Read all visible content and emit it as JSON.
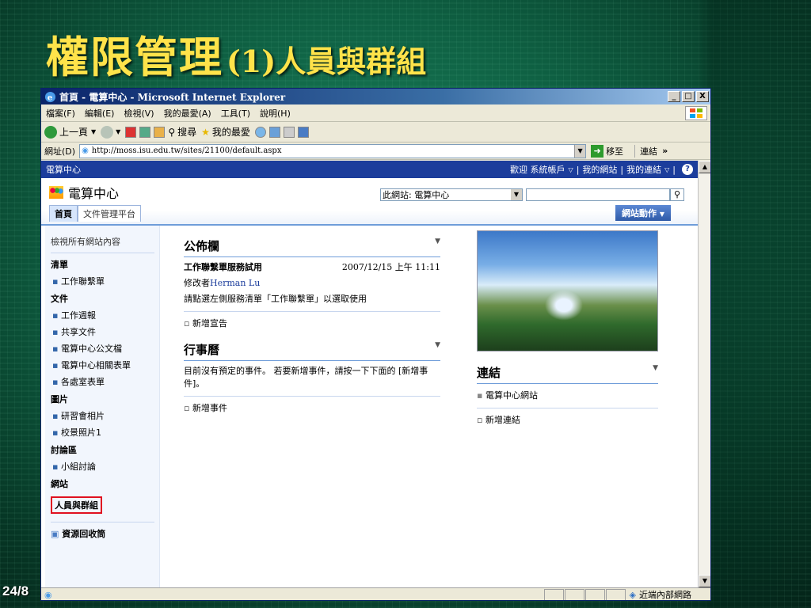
{
  "slide": {
    "title_main": "權限管理",
    "title_sub": "(1)人員與群組",
    "page_number": "24/8"
  },
  "window": {
    "title": "首頁 - 電算中心 - Microsoft Internet Explorer",
    "controls": [
      "_",
      "□",
      "X"
    ]
  },
  "menu": [
    "檔案(F)",
    "編輯(E)",
    "檢視(V)",
    "我的最愛(A)",
    "工具(T)",
    "說明(H)"
  ],
  "toolbar": {
    "back": "上一頁",
    "search": "搜尋",
    "favorites": "我的最愛"
  },
  "address": {
    "label": "網址(D)",
    "url": "http://moss.isu.edu.tw/sites/21100/default.aspx",
    "go": "移至",
    "links": "連結"
  },
  "topnav": {
    "site": "電算中心",
    "welcome": "歡迎 系統帳戶",
    "my_site": "我的網站",
    "my_links": "我的連結"
  },
  "header": {
    "site_name": "電算中心",
    "scope": "此網站: 電算中心",
    "tabs": [
      "首頁",
      "文件管理平台"
    ],
    "site_actions": "網站動作"
  },
  "leftnav": {
    "view_all": "檢視所有網站內容",
    "sections": [
      {
        "title": "清單",
        "items": [
          "工作聯繫單"
        ]
      },
      {
        "title": "文件",
        "items": [
          "工作週報",
          "共享文件",
          "電算中心公文檔",
          "電算中心相關表單",
          "各處室表單"
        ]
      },
      {
        "title": "圖片",
        "items": [
          "研習會相片",
          "校景照片1"
        ]
      },
      {
        "title": "討論區",
        "items": [
          "小組討論"
        ]
      }
    ],
    "site_section": "網站",
    "people_groups": "人員與群組",
    "recycle_bin": "資源回收筒"
  },
  "announcements": {
    "title": "公佈欄",
    "item_title": "工作聯繫單服務試用",
    "item_date": "2007/12/15 上午 11:11",
    "modified_prefix": "修改者",
    "modified_by": "Herman Lu",
    "body": "請點選左側服務清單「工作聯繫單」以選取使用",
    "add": "新增宣告"
  },
  "calendar": {
    "title": "行事曆",
    "body": "目前沒有預定的事件。 若要新增事件，請按一下下面的 [新增事件]。",
    "add": "新增事件"
  },
  "links": {
    "title": "連結",
    "item": "電算中心網站",
    "add": "新增連結"
  },
  "status": {
    "zone": "近端內部網路"
  }
}
